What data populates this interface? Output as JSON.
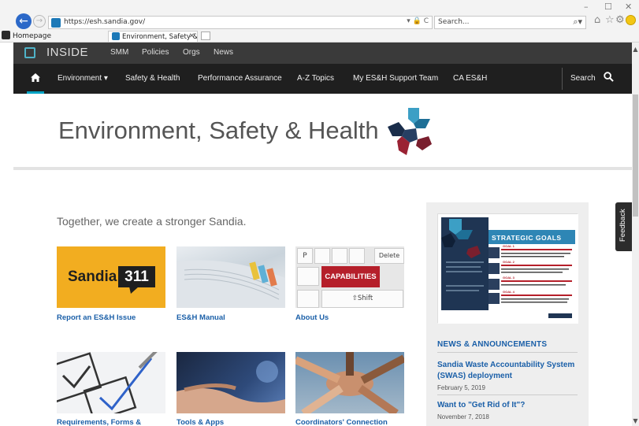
{
  "browser": {
    "url": "https://esh.sandia.gov/",
    "search_placeholder": "Search...",
    "favorites_item": "Homepage",
    "tab_title": "Environment, Safety & Heal...",
    "url_controls": "▾ 🔒 C",
    "search_glyph": "⌕▾"
  },
  "inside_bar": {
    "title": "INSIDE",
    "links": [
      "SMM",
      "Policies",
      "Orgs",
      "News"
    ]
  },
  "main_nav": {
    "items": [
      "Environment ▾",
      "Safety & Health",
      "Performance Assurance",
      "A-Z Topics",
      "My ES&H Support Team",
      "CA ES&H"
    ],
    "search_label": "Search"
  },
  "banner": {
    "title": "Environment, Safety & Health"
  },
  "content": {
    "tagline": "Together, we create a stronger Sandia.",
    "cards": [
      {
        "label": "Report an ES&H Issue",
        "image_text_1": "Sandia",
        "image_text_2": "311"
      },
      {
        "label": "ES&H Manual"
      },
      {
        "label": "About Us",
        "image_text": "CAPABILITIES",
        "key_p": "P",
        "key_delete": "Delete",
        "key_shift": "⇧Shift"
      },
      {
        "label": "Requirements, Forms &"
      },
      {
        "label": "Tools & Apps"
      },
      {
        "label": "Coordinators' Connection"
      }
    ]
  },
  "sidebar": {
    "goals_banner": "STRATEGIC GOALS",
    "goals": [
      "GOAL 1",
      "GOAL 2",
      "GOAL 3",
      "GOAL 4"
    ],
    "news_heading": "NEWS & ANNOUNCEMENTS",
    "news": [
      {
        "title": "Sandia Waste Accountability System (SWAS) deployment",
        "date": "February 5, 2019"
      },
      {
        "title": "Want to \"Get Rid of It\"?",
        "date": "November 7, 2018"
      }
    ]
  },
  "feedback_label": "Feedback",
  "colors": {
    "link_blue": "#1a5fa8",
    "nav_dark": "#1f1f1f",
    "inside_bar": "#3a3a3a",
    "accent_teal": "#00a3c4",
    "sandia311_bg": "#f2ad20",
    "capabilities_red": "#b51f2a"
  }
}
